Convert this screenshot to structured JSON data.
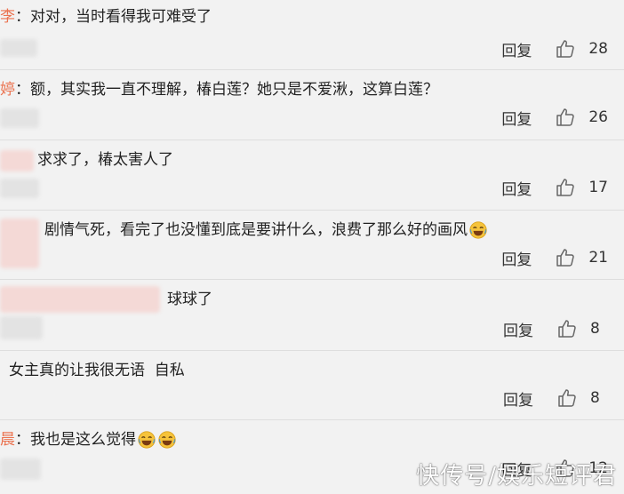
{
  "reply_label": "回复",
  "colors": {
    "username": "#eb7350",
    "background": "#f2f2f2",
    "text": "#222222"
  },
  "comments": [
    {
      "user": "李",
      "colon": "：",
      "text": "对对，当时看得我可难受了",
      "likes": "28"
    },
    {
      "user": "婷",
      "colon": "：",
      "text": "额，其实我一直不理解，椿白莲？她只是不爱湫，这算白莲？",
      "likes": "26"
    },
    {
      "user": "",
      "colon": "",
      "text": "求求了，椿太害人了",
      "likes": "17"
    },
    {
      "user": "",
      "colon": "",
      "text": "剧情气死，看完了也没懂到底是要讲什么，浪费了那么好的画风",
      "likes": "21",
      "emoji_count": 1
    },
    {
      "user": "",
      "colon": "",
      "text": "球球了",
      "likes": "8"
    },
    {
      "user": "",
      "colon": "",
      "text": "女主真的让我很无语  自私",
      "likes": "8"
    },
    {
      "user": "晨",
      "colon": "：",
      "text": "我也是这么觉得",
      "likes": "12",
      "emoji_count": 2
    }
  ],
  "watermark": "快传号/娱乐短评君",
  "icons": {
    "like": "thumbs-up-icon",
    "emoji": "laugh-cry-emoji-icon"
  }
}
